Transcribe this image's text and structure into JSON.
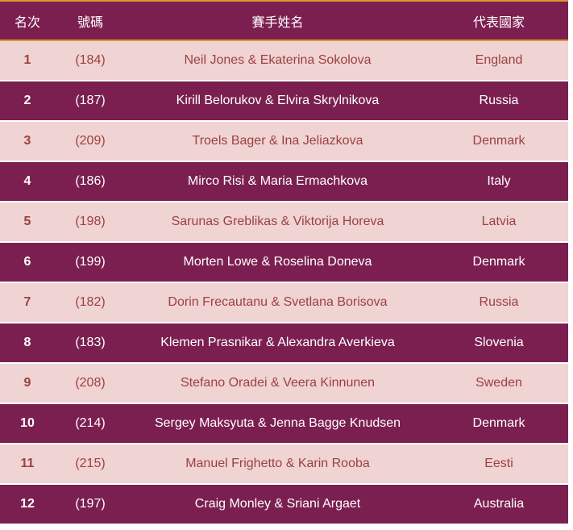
{
  "header": {
    "rank": "名次",
    "number": "號碼",
    "name": "賽手姓名",
    "country": "代表國家"
  },
  "rows": [
    {
      "rank": "1",
      "number": "(184)",
      "name": "Neil Jones & Ekaterina Sokolova",
      "country": "England"
    },
    {
      "rank": "2",
      "number": "(187)",
      "name": "Kirill Belorukov & Elvira Skrylnikova",
      "country": "Russia"
    },
    {
      "rank": "3",
      "number": "(209)",
      "name": "Troels Bager & Ina Jeliazkova",
      "country": "Denmark"
    },
    {
      "rank": "4",
      "number": "(186)",
      "name": "Mirco Risi & Maria Ermachkova",
      "country": "Italy"
    },
    {
      "rank": "5",
      "number": "(198)",
      "name": "Sarunas Greblikas & Viktorija Horeva",
      "country": "Latvia"
    },
    {
      "rank": "6",
      "number": "(199)",
      "name": "Morten Lowe & Roselina Doneva",
      "country": "Denmark"
    },
    {
      "rank": "7",
      "number": "(182)",
      "name": "Dorin Frecautanu & Svetlana Borisova",
      "country": "Russia"
    },
    {
      "rank": "8",
      "number": "(183)",
      "name": "Klemen Prasnikar & Alexandra Averkieva",
      "country": "Slovenia"
    },
    {
      "rank": "9",
      "number": "(208)",
      "name": "Stefano Oradei & Veera Kinnunen",
      "country": "Sweden"
    },
    {
      "rank": "10",
      "number": "(214)",
      "name": "Sergey Maksyuta & Jenna Bagge Knudsen",
      "country": "Denmark"
    },
    {
      "rank": "11",
      "number": "(215)",
      "name": "Manuel Frighetto & Karin Rooba",
      "country": "Eesti"
    },
    {
      "rank": "12",
      "number": "(197)",
      "name": "Craig Monley & Sriani Argaet",
      "country": "Australia"
    }
  ],
  "colors": {
    "dark_row": "#7b1f50",
    "light_row": "#f0d3d3",
    "light_text": "#9c4141",
    "accent_rule": "#d79a2e"
  }
}
